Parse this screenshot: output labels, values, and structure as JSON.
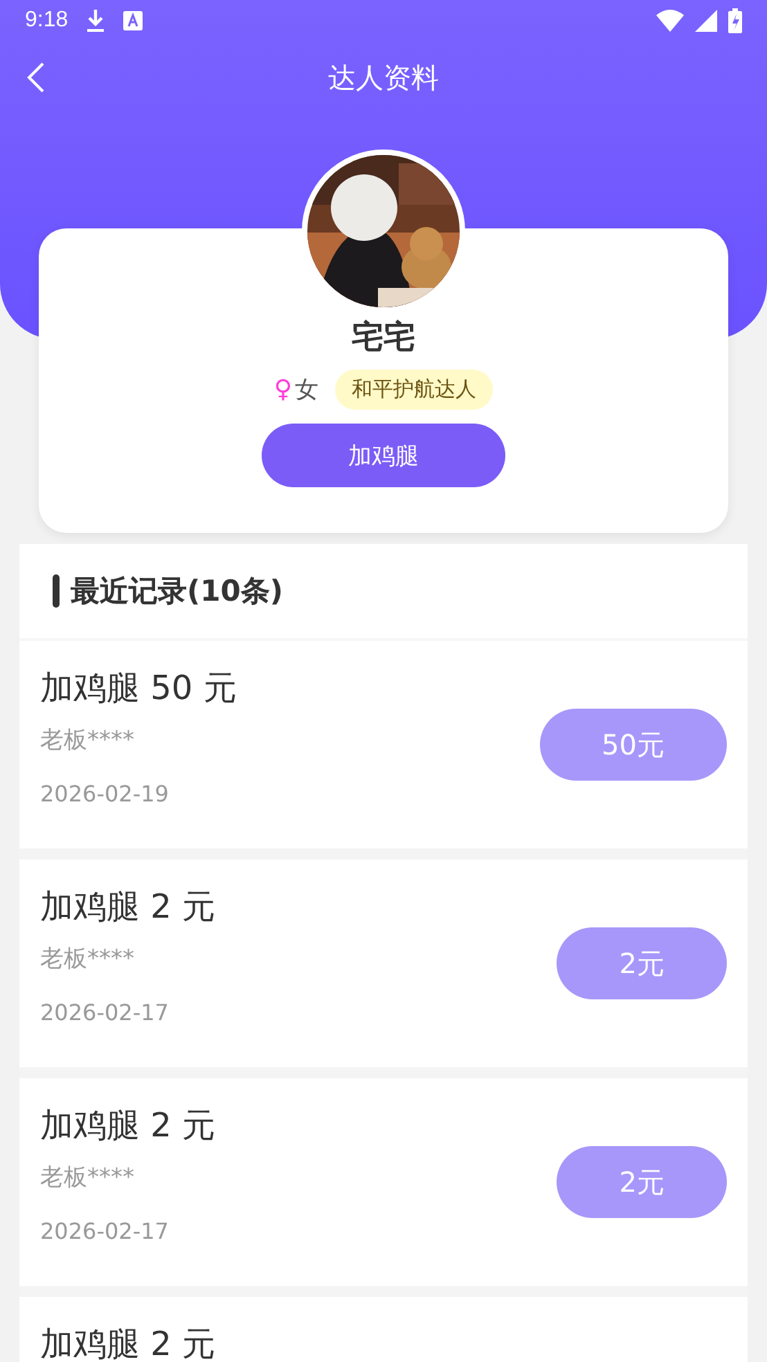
{
  "status_bar": {
    "time": "9:18"
  },
  "header": {
    "title": "达人资料"
  },
  "profile": {
    "name": "宅宅",
    "gender_symbol": "♀",
    "gender": "女",
    "tag": "和平护航达人",
    "action": "加鸡腿"
  },
  "records_section": {
    "title": "最近记录(10条)",
    "records": [
      {
        "title": "加鸡腿 50 元",
        "user": "老板****",
        "date": "2026-02-19",
        "amount": "50元"
      },
      {
        "title": "加鸡腿 2 元",
        "user": "老板****",
        "date": "2026-02-17",
        "amount": "2元"
      },
      {
        "title": "加鸡腿 2 元",
        "user": "老板****",
        "date": "2026-02-17",
        "amount": "2元"
      },
      {
        "title": "加鸡腿 2 元"
      }
    ]
  }
}
